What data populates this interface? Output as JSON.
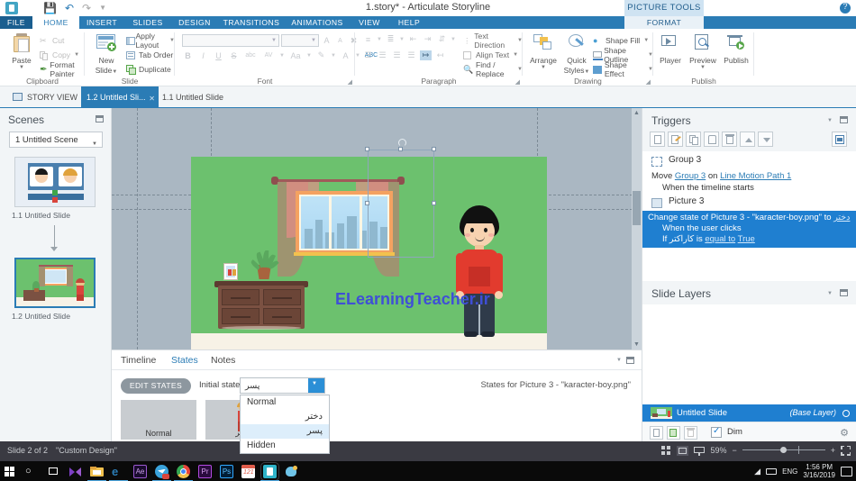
{
  "titlebar": {
    "document_title": "1.story* - Articulate Storyline",
    "picture_tools": "PICTURE TOOLS",
    "qat": [
      "save-icon",
      "undo-icon",
      "redo-icon",
      "customize-icon"
    ],
    "help_icon": "help-icon"
  },
  "ribbon_tabs": [
    {
      "label": "FILE",
      "key": "file"
    },
    {
      "label": "HOME",
      "key": "home",
      "active": true
    },
    {
      "label": "INSERT",
      "key": "insert"
    },
    {
      "label": "SLIDES",
      "key": "slides"
    },
    {
      "label": "DESIGN",
      "key": "design"
    },
    {
      "label": "TRANSITIONS",
      "key": "transitions"
    },
    {
      "label": "ANIMATIONS",
      "key": "animations"
    },
    {
      "label": "VIEW",
      "key": "view"
    },
    {
      "label": "HELP",
      "key": "help"
    },
    {
      "label": "FORMAT",
      "key": "format",
      "contextual": true
    }
  ],
  "ribbon": {
    "clipboard": {
      "group_label": "Clipboard",
      "paste": "Paste",
      "cut": "Cut",
      "copy": "Copy",
      "format_painter": "Format Painter"
    },
    "slide": {
      "group_label": "Slide",
      "new_slide": "New\nSlide",
      "new_slide_line1": "New",
      "new_slide_line2": "Slide",
      "apply_layout": "Apply Layout",
      "tab_order": "Tab Order",
      "duplicate": "Duplicate"
    },
    "font": {
      "group_label": "Font",
      "font_name": "",
      "font_size": "",
      "grow": "A",
      "shrink": "A",
      "clear_formatting": "clear-formatting-icon",
      "bold": "B",
      "italic": "I",
      "underline": "U",
      "strikethrough": "S",
      "subscript": "abc",
      "character_spacing": "AV",
      "change_case": "Aa",
      "highlight": "highlight-icon",
      "font_color": "A",
      "spelling": "ABC"
    },
    "paragraph": {
      "group_label": "Paragraph",
      "text_direction": "Text Direction",
      "align_text": "Align Text",
      "find_replace": "Find / Replace"
    },
    "drawing": {
      "group_label": "Drawing",
      "arrange": "Arrange",
      "quick_styles_line1": "Quick",
      "quick_styles_line2": "Styles",
      "shape_fill": "Shape Fill",
      "shape_outline": "Shape Outline",
      "shape_effect": "Shape Effect"
    },
    "publish": {
      "group_label": "Publish",
      "player": "Player",
      "preview": "Preview",
      "publish": "Publish"
    }
  },
  "viewbar": {
    "story_view": "STORY VIEW",
    "tabs": [
      {
        "label": "1.2 Untitled Sli...",
        "active": true,
        "closable": true
      },
      {
        "label": "1.1 Untitled Slide",
        "active": false,
        "closable": false
      }
    ],
    "watermark": "ELearningTeacher.ir",
    "device_icons": [
      "desktop-icon",
      "tablet-landscape-icon",
      "tablet-portrait-icon",
      "phone-landscape-icon",
      "phone-portrait-icon",
      "gear-icon"
    ]
  },
  "scenes": {
    "title": "Scenes",
    "scene_select": "1 Untitled Scene",
    "slides": [
      {
        "label": "1.1 Untitled Slide",
        "selected": false
      },
      {
        "label": "1.2 Untitled Slide",
        "selected": true
      }
    ]
  },
  "canvas": {
    "watermark": "ELearningTeacher.ir",
    "selected_object": "Picture 3"
  },
  "bottom_panel": {
    "tabs": [
      {
        "label": "Timeline",
        "selected": false
      },
      {
        "label": "States",
        "selected": true
      },
      {
        "label": "Notes",
        "selected": false
      }
    ],
    "edit_states": "EDIT STATES",
    "initial_state_label": "Initial state:",
    "initial_state_value": "پسر",
    "states_for": "States for Picture 3 - \"karacter-boy.png\"",
    "dropdown_options": [
      {
        "label": "Normal",
        "rtl": false,
        "highlighted": false
      },
      {
        "label": "دختر",
        "rtl": true,
        "highlighted": false
      },
      {
        "label": "پسر",
        "rtl": true,
        "highlighted": true
      },
      {
        "label": "Hidden",
        "rtl": false,
        "highlighted": false
      }
    ],
    "state_thumbs": [
      {
        "caption": "Normal",
        "rtl": false
      },
      {
        "caption": "دختر",
        "rtl": true
      }
    ]
  },
  "triggers": {
    "title": "Triggers",
    "toolbar": [
      "new-trigger-icon",
      "edit-trigger-icon",
      "copy-trigger-icon",
      "paste-trigger-icon",
      "delete-trigger-icon",
      "move-up-icon",
      "move-down-icon",
      "trigger-wizard-icon"
    ],
    "groups": [
      {
        "object": "Group 3",
        "icon": "group-icon",
        "lines": [
          {
            "prefix": "Move ",
            "link1": "Group 3",
            "mid": " on ",
            "link2": "Line Motion Path 1",
            "suffix": ""
          },
          {
            "text": "When the timeline starts",
            "indent": true
          }
        ]
      },
      {
        "object": "Picture 3",
        "icon": "picture-icon",
        "highlighted": true,
        "lines": [
          {
            "text": "Change state of Picture 3 - \"karacter-boy.png\" to ",
            "link": "دختر",
            "rtl_link": true
          },
          {
            "text": "When the user clicks",
            "indent": true
          },
          {
            "prefix": "If ",
            "rtl_word": "کاراکتر",
            "mid": " is ",
            "link1": "equal to",
            "link2": "True",
            "indent": true
          }
        ]
      }
    ]
  },
  "slide_layers": {
    "title": "Slide Layers",
    "rows": [
      {
        "name": "Untitled Slide",
        "badge": "(Base Layer)",
        "selected": true
      }
    ],
    "toolbar": [
      "new-layer-icon",
      "edit-layer-icon",
      "delete-layer-icon"
    ],
    "dim_label": "Dim",
    "dim_checked": true,
    "settings_icon": "gear-icon"
  },
  "statusbar": {
    "slide_count": "Slide 2 of 2",
    "design": "\"Custom Design\"",
    "view_icons": [
      "grid-view-icon",
      "normal-view-icon",
      "presenter-view-icon"
    ],
    "zoom_percent": "59%",
    "zoom_out": "−",
    "zoom_in": "+",
    "fit_icon": "fit-to-window-icon"
  },
  "taskbar": {
    "items": [
      {
        "name": "start-icon",
        "color": "#ffffff"
      },
      {
        "name": "search-icon",
        "color": "#ffffff"
      },
      {
        "name": "task-view-icon",
        "color": "#ffffff"
      },
      {
        "name": "storyline-icon",
        "color": "#7d3fc4"
      },
      {
        "name": "file-explorer-icon",
        "color": "#f2c14e"
      },
      {
        "name": "edge-icon",
        "color": "#2b7cb5"
      },
      {
        "name": "after-effects-icon",
        "color": "#9b59d0"
      },
      {
        "name": "telegram-icon",
        "color": "#3aa3dc"
      },
      {
        "name": "chrome-icon",
        "color": "#e8453c"
      },
      {
        "name": "premiere-icon",
        "color": "#b24ae0"
      },
      {
        "name": "photoshop-icon",
        "color": "#31a8ff"
      },
      {
        "name": "calendar-icon",
        "color": "#e05c4a"
      },
      {
        "name": "storyline-active-icon",
        "color": "#2fb3c9",
        "active": true
      },
      {
        "name": "paint3d-icon",
        "color": "#6fc4e8"
      }
    ],
    "tray": {
      "network_icon": "network-icon",
      "battery_icon": "battery-icon",
      "language": "ENG",
      "time": "1:56 PM",
      "date": "3/16/2019",
      "notifications": "notification-icon"
    }
  }
}
